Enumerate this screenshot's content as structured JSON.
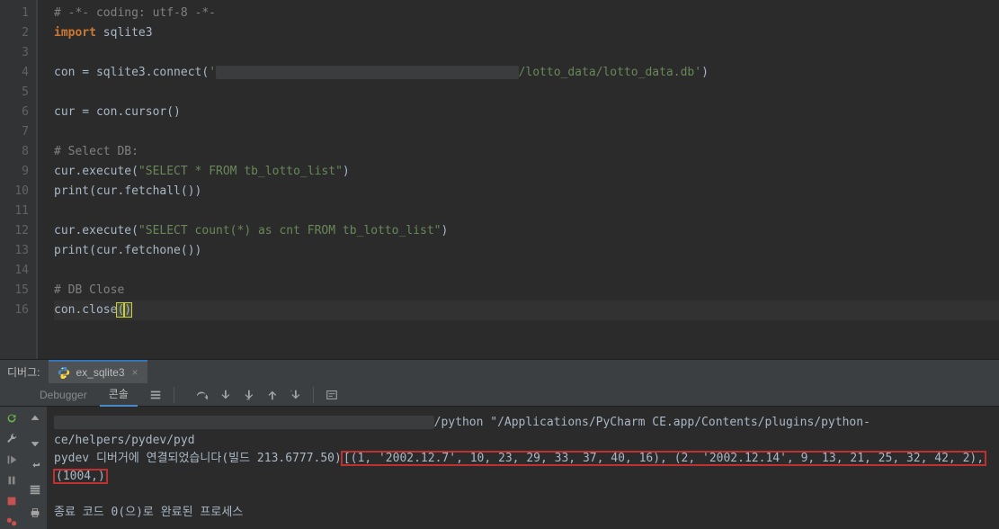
{
  "gutter": {
    "lines": [
      "1",
      "2",
      "3",
      "4",
      "5",
      "6",
      "7",
      "8",
      "9",
      "10",
      "11",
      "12",
      "13",
      "14",
      "15",
      "16"
    ]
  },
  "code": {
    "l1": {
      "a": "# -*- coding: utf-8 -*-"
    },
    "l2": {
      "a": "import",
      "b": " sqlite3"
    },
    "l4": {
      "a": "con = sqlite3.connect(",
      "b": "'",
      "c": "/xxxxxxxxxxxxxxxx/xxxxxxxxxxxxxxxxxxxxxxxxx",
      "d": "/lotto_data/lotto_data.db'",
      "e": ")"
    },
    "l6": {
      "a": "cur = con.cursor()"
    },
    "l8": {
      "a": "# Select DB:"
    },
    "l9": {
      "a": "cur.execute(",
      "b": "\"SELECT * FROM tb_lotto_list\"",
      "c": ")"
    },
    "l10": {
      "a": "print",
      "b": "(cur.fetchall())"
    },
    "l12": {
      "a": "cur.execute(",
      "b": "\"SELECT count(*) as cnt FROM tb_lotto_list\"",
      "c": ")"
    },
    "l13": {
      "a": "print",
      "b": "(cur.fetchone())"
    },
    "l15": {
      "a": "# DB Close"
    },
    "l16": {
      "a": "con.close",
      "b": "(",
      "c": ")"
    }
  },
  "debug": {
    "panel_label": "디버그:",
    "tab_label": "ex_sqlite3",
    "subtabs": {
      "debugger": "Debugger",
      "console": "콘솔"
    },
    "console": {
      "line1_blur": "/xxxxxxxxxxxxxxxxxxxxxxxxxxxxxxxxxxxxxxxxxxxxxxxxxxxxx",
      "line1_rest": "/python \"/Applications/PyCharm CE.app/Contents/plugins/python-ce/helpers/pydev/pyd",
      "line2_pre": "pydev 디버거에 연결되었습니다(빌드 213.6777.50)",
      "line2_box": "[(1, '2002.12.7', 10, 23, 29, 33, 37, 40, 16), (2, '2002.12.14', 9, 13, 21, 25, 32, 42, 2),",
      "line3_box": "(1004,)",
      "line5": "종료 코드 0(으)로 완료된 프로세스"
    }
  }
}
